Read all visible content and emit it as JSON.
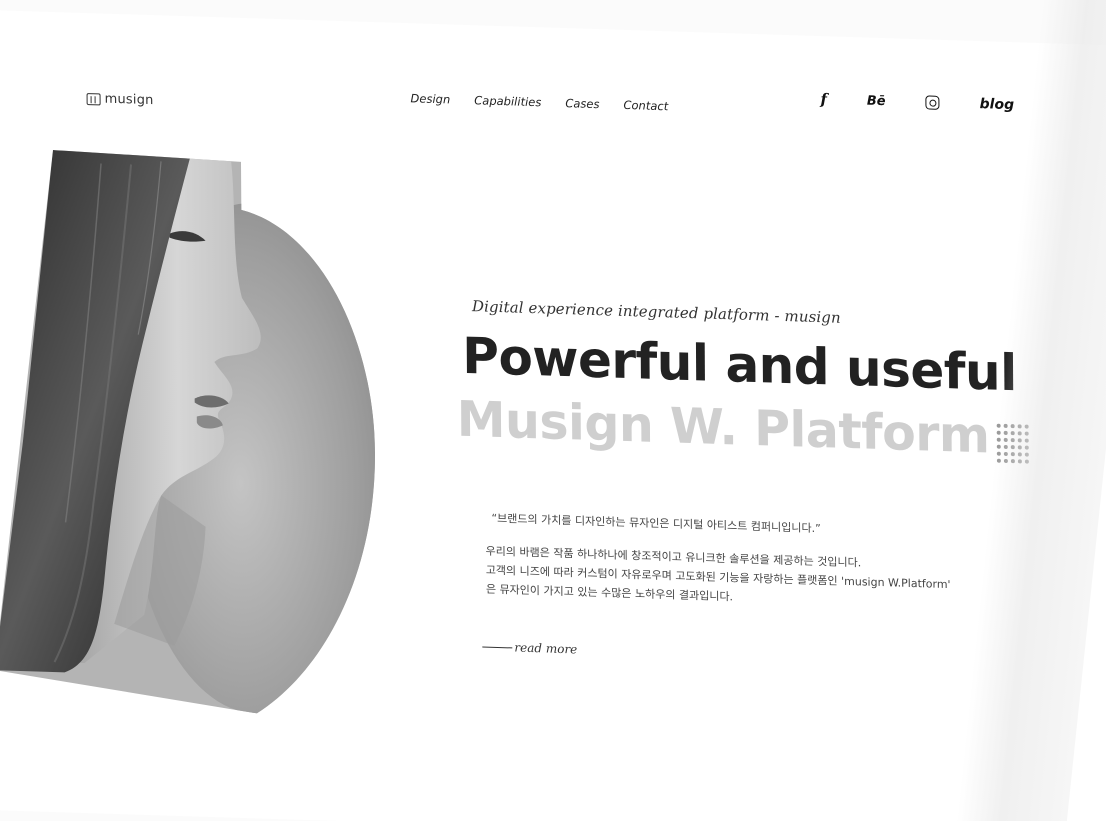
{
  "header": {
    "logo_text": "musign",
    "nav": [
      {
        "label": "Design"
      },
      {
        "label": "Capabilities"
      },
      {
        "label": "Cases"
      },
      {
        "label": "Contact"
      }
    ],
    "social": {
      "facebook_label": "f",
      "behance_label": "Bē",
      "instagram_icon": "instagram-icon",
      "blog_label": "blog"
    }
  },
  "hero": {
    "tagline": "Digital experience integrated platform - musign",
    "headline": "Powerful and useful",
    "subhead": "Musign W. Platform",
    "quote": "“브랜드의 가치를 디자인하는 뮤자인은 디지털 아티스트 컴퍼니입니다.”",
    "body_lines": [
      "우리의 바램은 작품 하나하나에 창조적이고 유니크한 솔루션을 제공하는 것입니다.",
      "고객의 니즈에 따라 커스텀이 자유로우며 고도화된 기능을 자랑하는 플랫폼인 'musign W.Platform'",
      "은 뮤자인이 가지고 있는 수많은 노하우의 결과입니다."
    ],
    "read_more": "read more"
  },
  "colors": {
    "headline": "#222222",
    "subhead": "#cfcfcf",
    "background": "#ffffff"
  }
}
